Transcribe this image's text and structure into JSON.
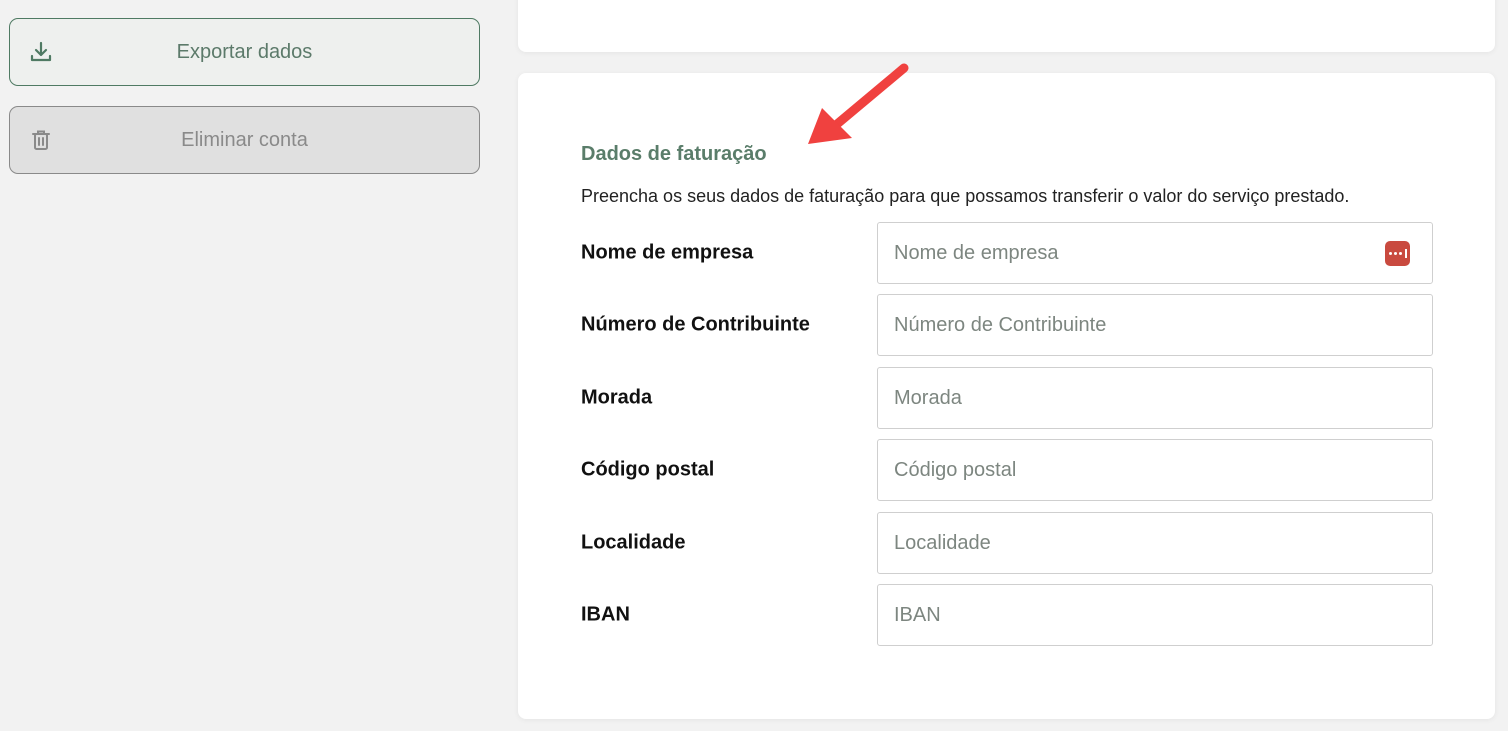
{
  "sidebar": {
    "export_label": "Exportar dados",
    "delete_label": "Eliminar conta"
  },
  "billing": {
    "title": "Dados de faturação",
    "description": "Preencha os seus dados de faturação para que possamos transferir o valor do serviço prestado.",
    "fields": [
      {
        "label": "Nome de empresa",
        "placeholder": "Nome de empresa",
        "value": ""
      },
      {
        "label": "Número de Contribuinte",
        "placeholder": "Número de Contribuinte",
        "value": ""
      },
      {
        "label": "Morada",
        "placeholder": "Morada",
        "value": ""
      },
      {
        "label": "Código postal",
        "placeholder": "Código postal",
        "value": ""
      },
      {
        "label": "Localidade",
        "placeholder": "Localidade",
        "value": ""
      },
      {
        "label": "IBAN",
        "placeholder": "IBAN",
        "value": ""
      }
    ]
  },
  "colors": {
    "accent_green": "#5a7d6a",
    "annotation_arrow": "#f0413f",
    "password_manager_icon": "#c94a3f"
  },
  "icons": {
    "export": "download-icon",
    "delete": "trash-icon",
    "autofill": "password-manager-icon",
    "annotation": "red-arrow-icon"
  }
}
